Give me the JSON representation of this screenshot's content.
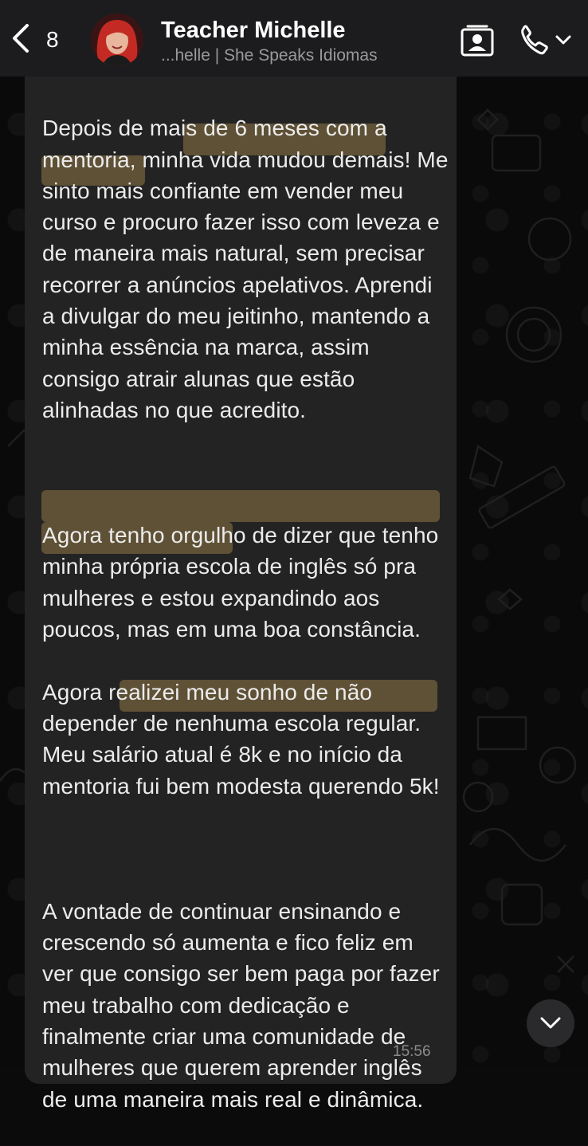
{
  "header": {
    "back_count": "8",
    "contact_name": "Teacher Michelle",
    "contact_subtitle": "...helle | She Speaks Idiomas",
    "icons": [
      "back-chevron-icon",
      "contact-card-icon",
      "phone-icon",
      "chevron-down-icon"
    ]
  },
  "message": {
    "paragraph1": "Depois de mais de 6 meses com a mentoria, minha vida mudou demais! Me sinto mais confiante em vender meu curso e procuro fazer isso com leveza e de maneira mais natural, sem precisar recorrer a anúncios apelativos. Aprendi a divulgar do meu jeitinho, mantendo a minha essência na marca, assim consigo atrair alunas que estão alinhadas no que acredito.",
    "paragraph2": "Agora tenho orgulho de dizer que tenho minha própria escola de inglês só pra mulheres e estou expandindo aos poucos, mas em uma boa constância.",
    "paragraph3": "Agora realizei meu sonho de não depender de nenhuma escola regular. Meu salário atual é 8k e no início da mentoria fui bem modesta querendo 5k!",
    "paragraph4": "A vontade de continuar ensinando e crescendo só aumenta e fico feliz em ver que consigo ser bem paga por fazer meu trabalho com dedicação e finalmente criar uma comunidade de mulheres que querem aprender inglês de uma maneira mais real e dinâmica.",
    "time": "15:56"
  },
  "colors": {
    "header_bg": "#1c1c1e",
    "bubble_bg": "#232323",
    "highlight": "#846e42",
    "text": "#ececec"
  }
}
